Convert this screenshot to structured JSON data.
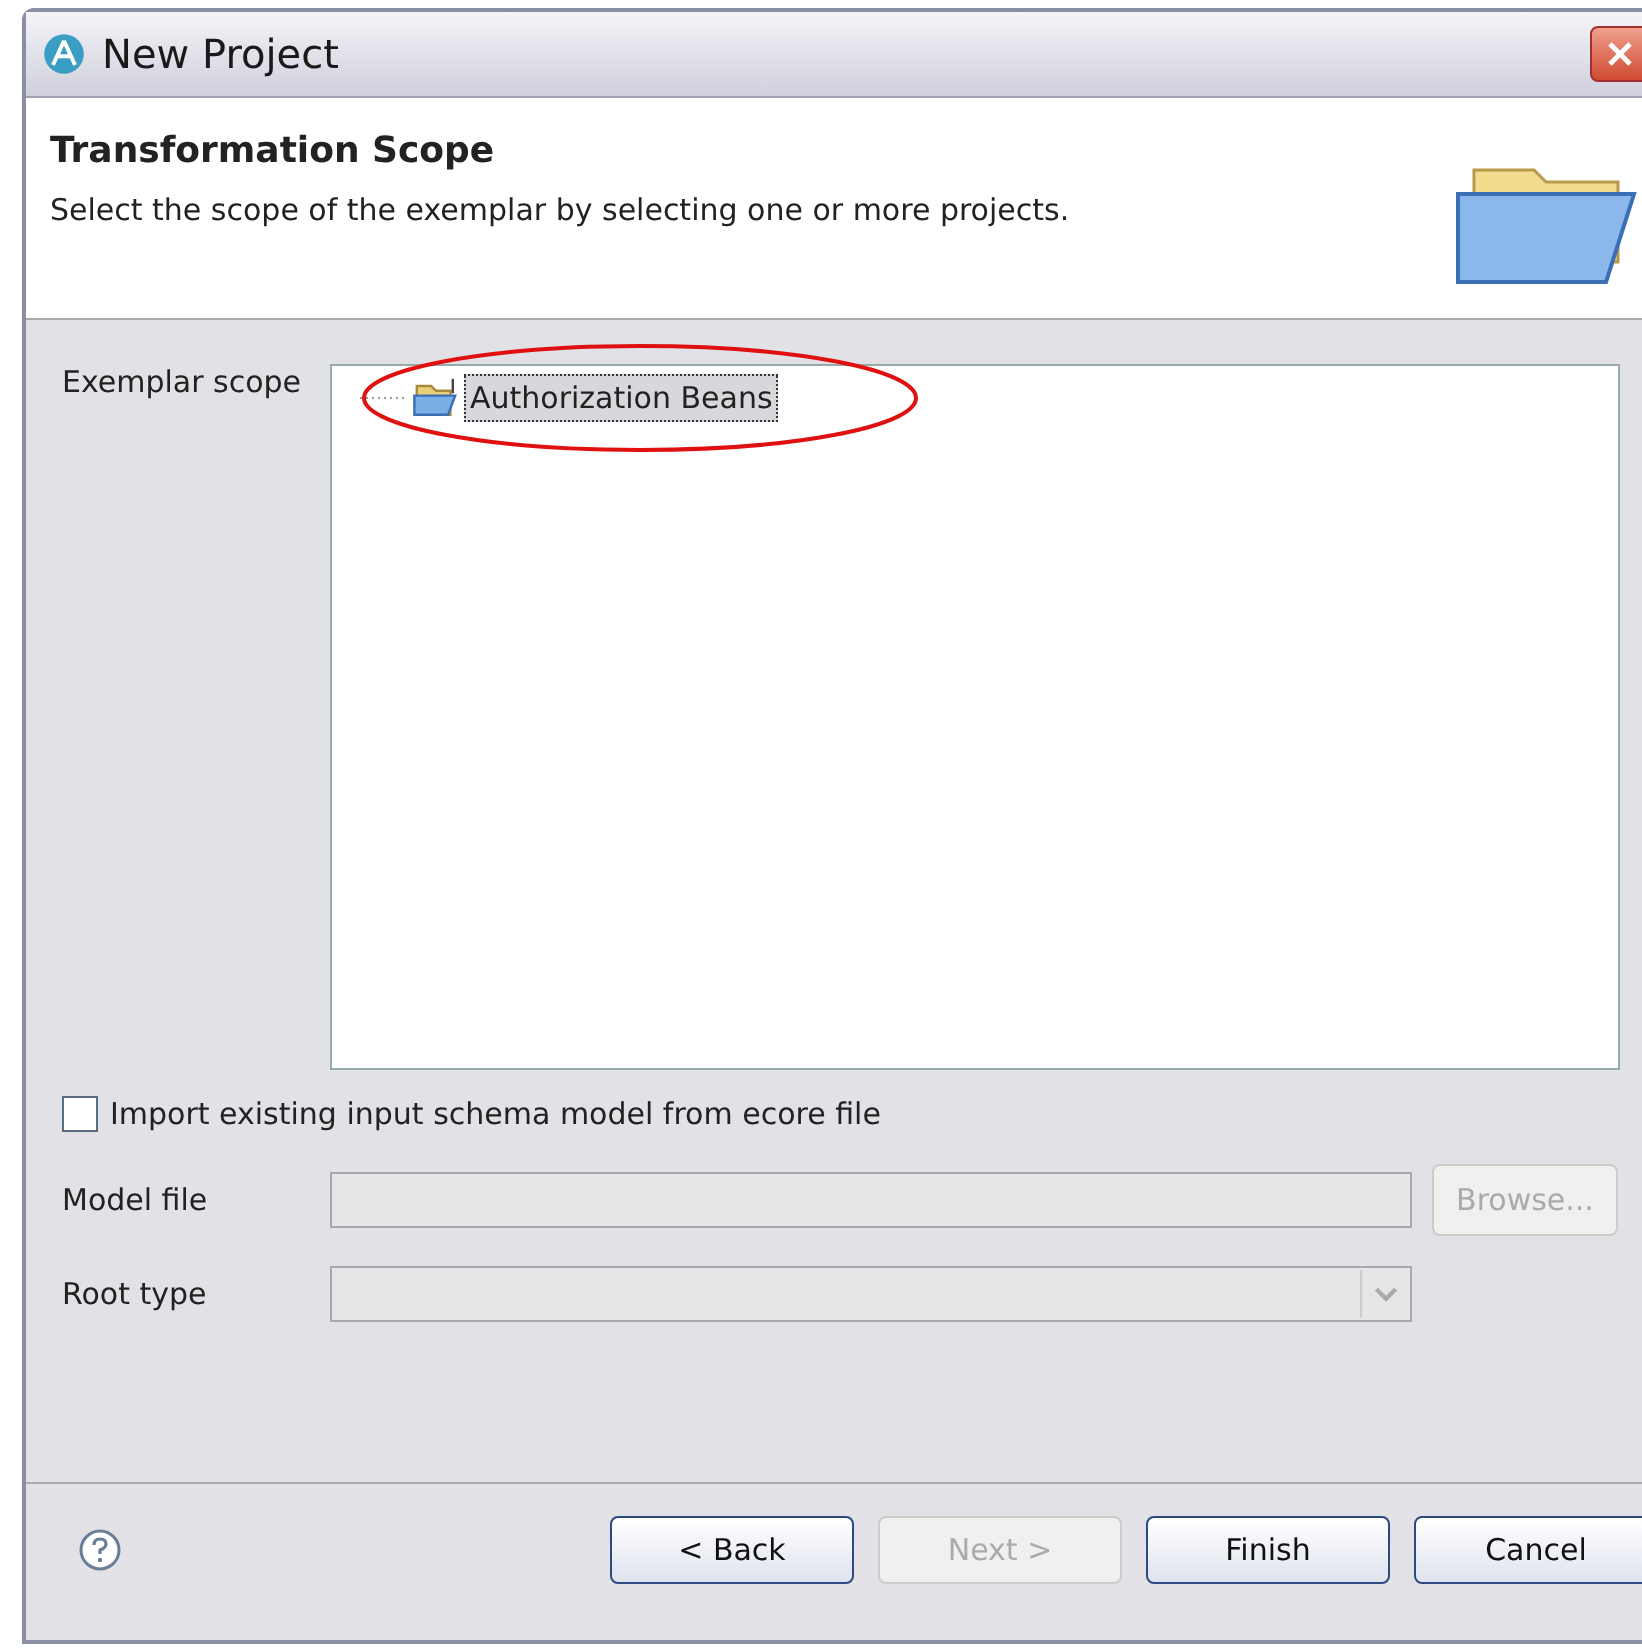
{
  "window": {
    "title": "New Project"
  },
  "header": {
    "title": "Transformation Scope",
    "description": "Select the scope of the exemplar by selecting one or more projects."
  },
  "scope": {
    "label": "Exemplar scope",
    "items": [
      {
        "label": "Authorization Beans",
        "selected": true
      }
    ]
  },
  "import_checkbox": {
    "label": "Import existing input schema model from ecore file",
    "checked": false
  },
  "model_file": {
    "label": "Model file",
    "disabled": true,
    "browse": {
      "label": "Browse...",
      "disabled": true
    }
  },
  "root_type": {
    "label": "Root type",
    "disabled": true
  },
  "buttons": [
    {
      "label": "< Back",
      "disabled": false
    },
    {
      "label": "Next >",
      "disabled": true
    },
    {
      "label": "Finish",
      "disabled": false
    },
    {
      "label": "Cancel",
      "disabled": false
    }
  ]
}
